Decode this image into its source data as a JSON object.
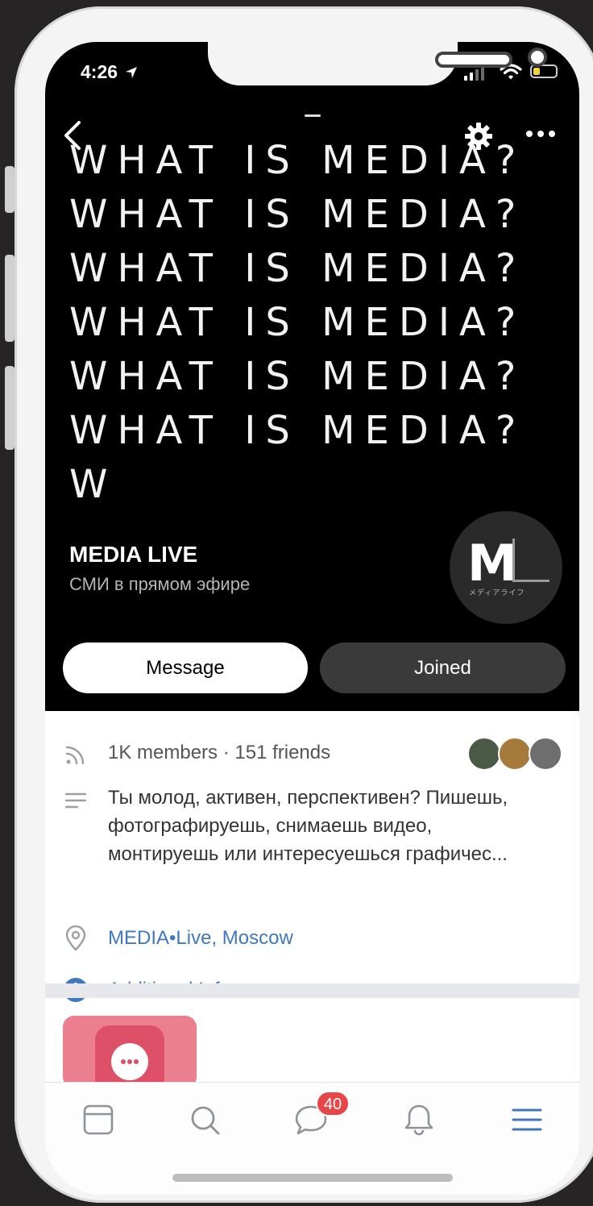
{
  "status_bar": {
    "time": "4:26"
  },
  "cover": {
    "lines": [
      "WHAT IS MEDIA?",
      "WHAT IS MEDIA?",
      "WHAT IS MEDIA?",
      "WHAT IS MEDIA?",
      "WHAT IS MEDIA?",
      "WHAT IS MEDIA?",
      "W"
    ]
  },
  "group": {
    "name": "MEDIA LIVE",
    "subtitle": "СМИ в прямом эфире",
    "avatar_letter": "M",
    "avatar_caption": "メディアライフ"
  },
  "actions": {
    "message_label": "Message",
    "joined_label": "Joined"
  },
  "info": {
    "members": "1K members · 151 friends",
    "description_line1": "Ты молод, активен, перспективен? Пишешь,",
    "description_line2": "фотографируешь, снимаешь видео,",
    "description_line3": "монтируешь или интересуешься графичес...",
    "location": "MEDIA•Live, Moscow",
    "additional_info": "Additional Info"
  },
  "tabbar": {
    "messages_badge": "40"
  },
  "colors": {
    "accent": "#3f78c1",
    "badge": "#e64646",
    "hero_bg": "#000000",
    "joined_bg": "#3a3a3a"
  },
  "icons": {
    "back": "chevron-left-icon",
    "settings": "gear-icon",
    "more": "more-dots-icon",
    "members": "rss-icon",
    "description": "text-lines-icon",
    "location": "location-pin-icon",
    "additional": "info-circle-icon",
    "tab_feed": "feed-icon",
    "tab_search": "search-icon",
    "tab_messages": "chat-bubble-icon",
    "tab_notifications": "bell-icon",
    "tab_menu": "menu-icon"
  }
}
